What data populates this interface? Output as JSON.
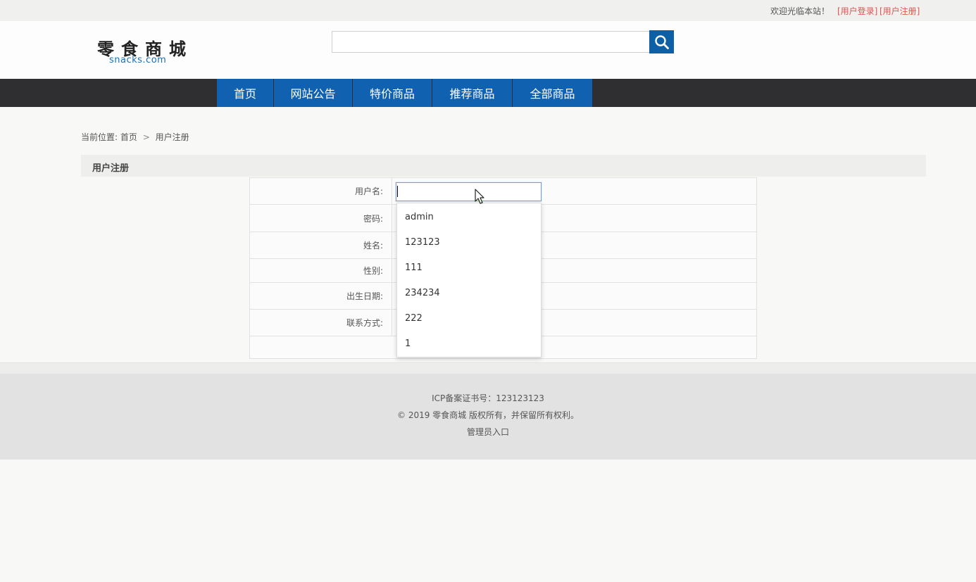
{
  "topbar": {
    "welcome": "欢迎光临本站！",
    "login_link": "[用户登录]",
    "register_link": "[用户注册]"
  },
  "header": {
    "logo_cn": "零食商城",
    "logo_en": "snacks.com",
    "search": {
      "value": "",
      "icon": "search-icon"
    }
  },
  "nav": {
    "items": [
      "首页",
      "网站公告",
      "特价商品",
      "推荐商品",
      "全部商品"
    ]
  },
  "breadcrumb": {
    "prefix": "当前位置:",
    "home": "首页",
    "separator": ">",
    "current": "用户注册"
  },
  "panel": {
    "title": "用户注册"
  },
  "form": {
    "labels": [
      "用户名:",
      "密码:",
      "姓名:",
      "性别:",
      "出生日期:",
      "联系方式:"
    ],
    "username_value": ""
  },
  "autocomplete": {
    "options": [
      "admin",
      "123123",
      "111",
      "234234",
      "222",
      "1"
    ]
  },
  "footer": {
    "icp": "ICP备案证书号：123123123",
    "copyright": "© 2019 零食商城 版权所有，并保留所有权利。",
    "admin_link": "管理员入口"
  },
  "colors": {
    "nav_bg": "#2f2f32",
    "nav_active": "#1062b0",
    "link_red": "#e0544f",
    "search_btn": "#0d5fa6"
  }
}
